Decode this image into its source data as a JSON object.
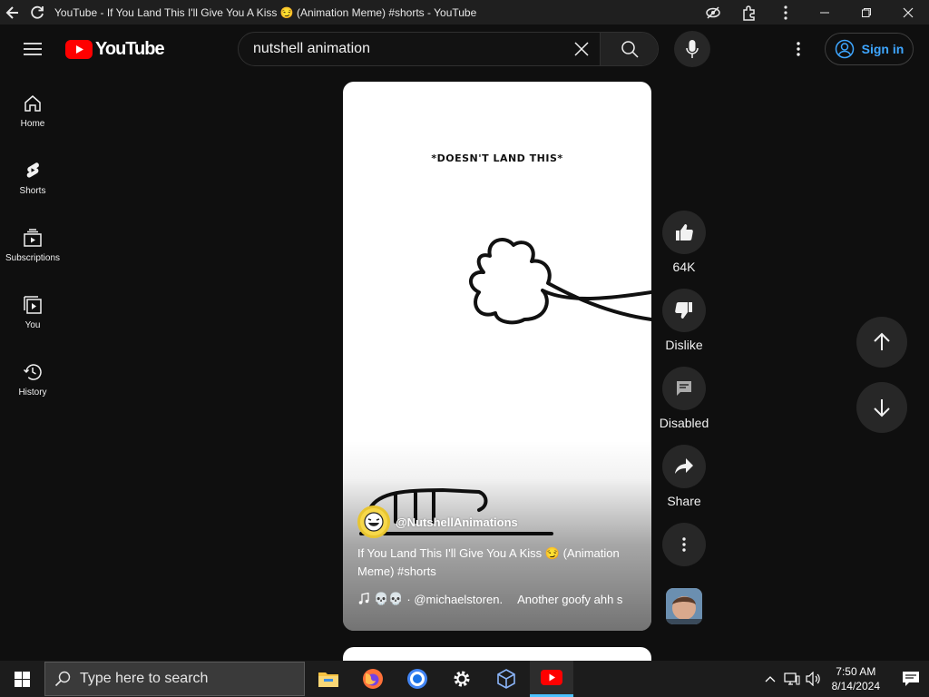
{
  "window": {
    "title": "YouTube - If You Land This I'll Give You A Kiss 😏 (Animation Meme) #shorts - YouTube"
  },
  "masthead": {
    "logo_text": "YouTube",
    "search_value": "nutshell animation",
    "signin_label": "Sign in"
  },
  "sidebar": {
    "items": [
      {
        "label": "Home",
        "icon": "home-icon"
      },
      {
        "label": "Shorts",
        "icon": "shorts-icon"
      },
      {
        "label": "Subscriptions",
        "icon": "subscriptions-icon"
      },
      {
        "label": "You",
        "icon": "you-icon"
      },
      {
        "label": "History",
        "icon": "history-icon"
      }
    ]
  },
  "short": {
    "caption": "*DOESN'T LAND THIS*",
    "channel": "@NutshellAnimations",
    "title": "If You Land This I'll Give You A Kiss 😏 (Animation Meme) #shorts",
    "music_emoji": "💀💀",
    "music_text": "· @michaelstoren.",
    "music_extra": "Another goofy ahh s"
  },
  "actions": {
    "like_label": "64K",
    "dislike_label": "Dislike",
    "comments_label": "Disabled",
    "share_label": "Share"
  },
  "taskbar": {
    "search_placeholder": "Type here to search",
    "time": "7:50 AM",
    "date": "8/14/2024"
  },
  "colors": {
    "background": "#0f0f0f",
    "youtube_red": "#ff0000",
    "link_blue": "#3ea6ff",
    "button_gray": "#272727"
  }
}
